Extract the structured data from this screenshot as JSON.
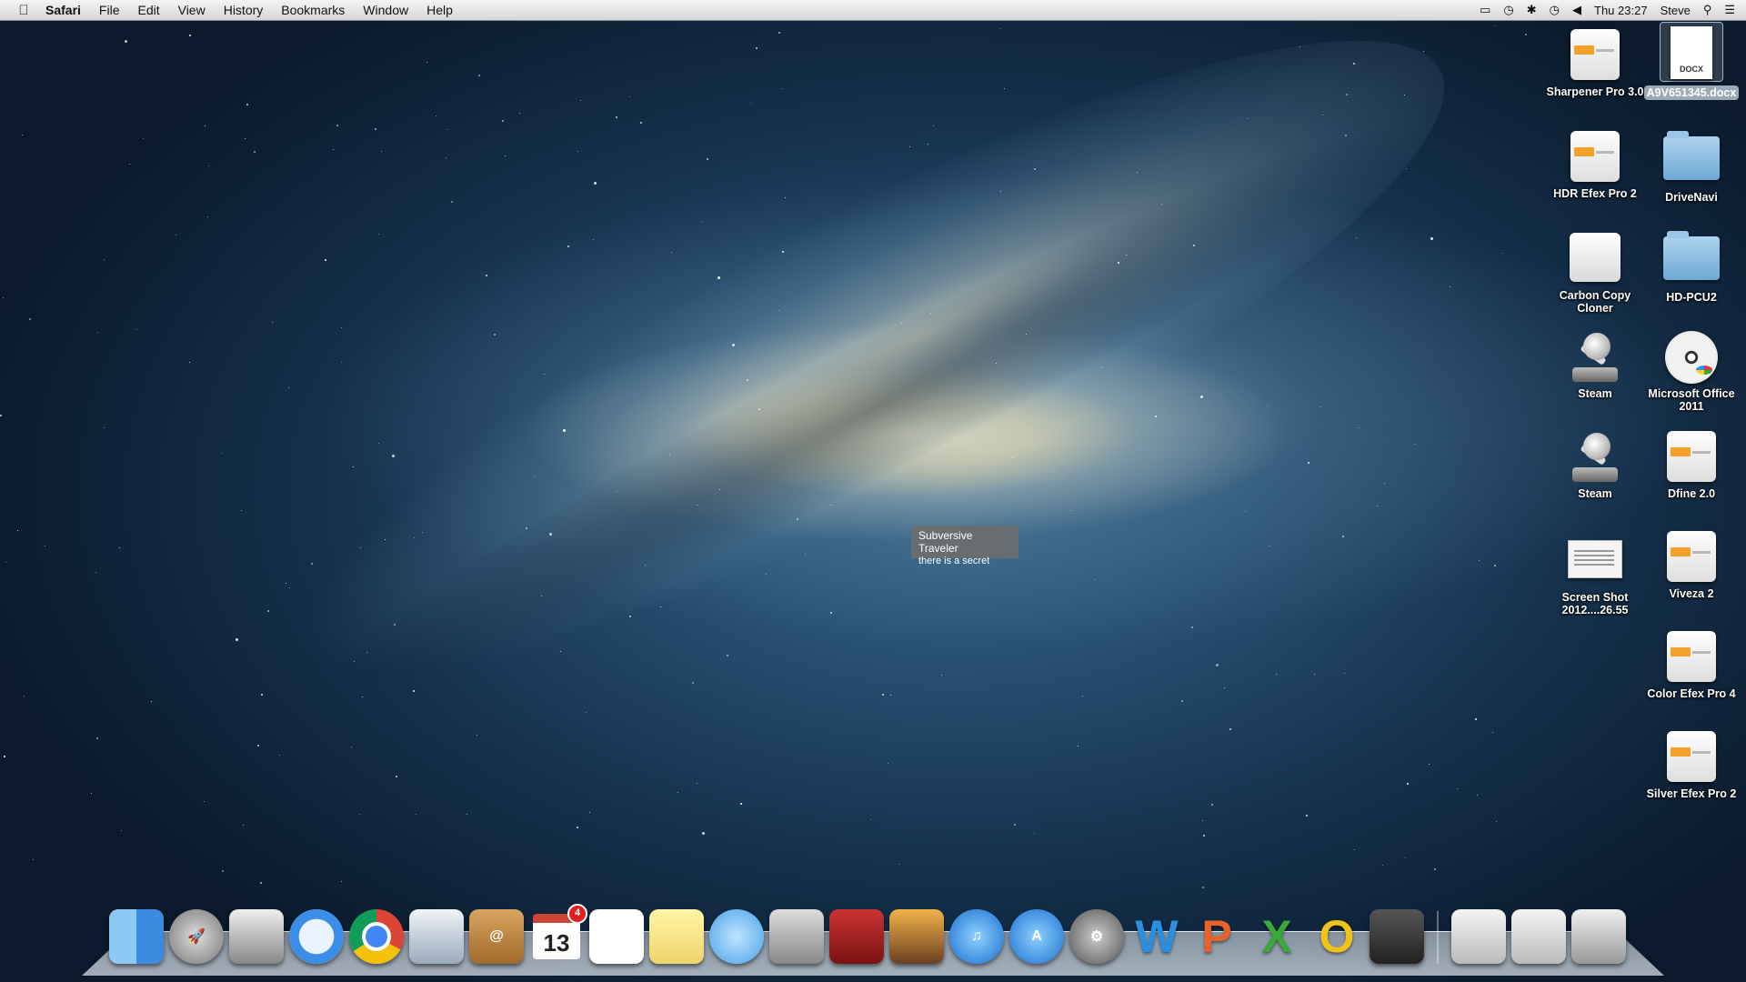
{
  "menubar": {
    "app_name": "Safari",
    "menus": [
      "File",
      "Edit",
      "View",
      "History",
      "Bookmarks",
      "Window",
      "Help"
    ],
    "clock": "Thu 23:27",
    "user": "Steve",
    "status_icons": [
      "airplay-icon",
      "time-machine-icon",
      "bluetooth-icon",
      "wifi-icon",
      "volume-icon",
      "spotlight-icon",
      "notification-center-icon"
    ]
  },
  "desktop_icons": [
    {
      "label": "Sharpener Pro 3.0",
      "kind": "nik"
    },
    {
      "label": "A9V651345.docx",
      "kind": "docx",
      "doc_type": "DOCX",
      "selected": true
    },
    {
      "label": "HDR Efex Pro 2",
      "kind": "nik"
    },
    {
      "label": "DriveNavi",
      "kind": "folder"
    },
    {
      "label": "Carbon Copy Cloner",
      "kind": "drive"
    },
    {
      "label": "HD-PCU2",
      "kind": "folder"
    },
    {
      "label": "Steam",
      "kind": "steam"
    },
    {
      "label": "Microsoft Office 2011",
      "kind": "disc"
    },
    {
      "label": "Steam",
      "kind": "steam"
    },
    {
      "label": "Dfine 2.0",
      "kind": "nik"
    },
    {
      "label": "Screen Shot 2012....26.55",
      "kind": "screenshot"
    },
    {
      "label": "Viveza 2",
      "kind": "nik"
    },
    {
      "label": "Color Efex Pro 4",
      "kind": "nik"
    },
    {
      "label": "Silver Efex Pro 2",
      "kind": "nik"
    }
  ],
  "tooltip": {
    "title": "Subversive Traveler",
    "subtitle": "there is a secret"
  },
  "dock": {
    "apps": [
      "Finder",
      "Launchpad",
      "Image Capture",
      "Safari",
      "Google Chrome",
      "Mail",
      "Contacts",
      "Calendar",
      "Reminders",
      "Notes",
      "Messages",
      "FaceTime",
      "Photo Booth",
      "iPhoto",
      "iTunes",
      "App Store",
      "System Preferences",
      "Microsoft Word",
      "Microsoft PowerPoint",
      "Microsoft Excel",
      "Microsoft Outlook",
      "Steam"
    ],
    "calendar_month": "DEC",
    "calendar_day": "13",
    "calendar_badge": "4",
    "letters": {
      "word": "W",
      "powerpoint": "P",
      "excel": "X",
      "outlook": "O"
    },
    "right": [
      "Documents",
      "Downloads",
      "Trash"
    ]
  },
  "colors": {
    "menubar": "#e6e6e6",
    "tooltip": "#6e6e6e",
    "nik_orange": "#f3a12a",
    "folder_blue": "#8cc0e4"
  }
}
